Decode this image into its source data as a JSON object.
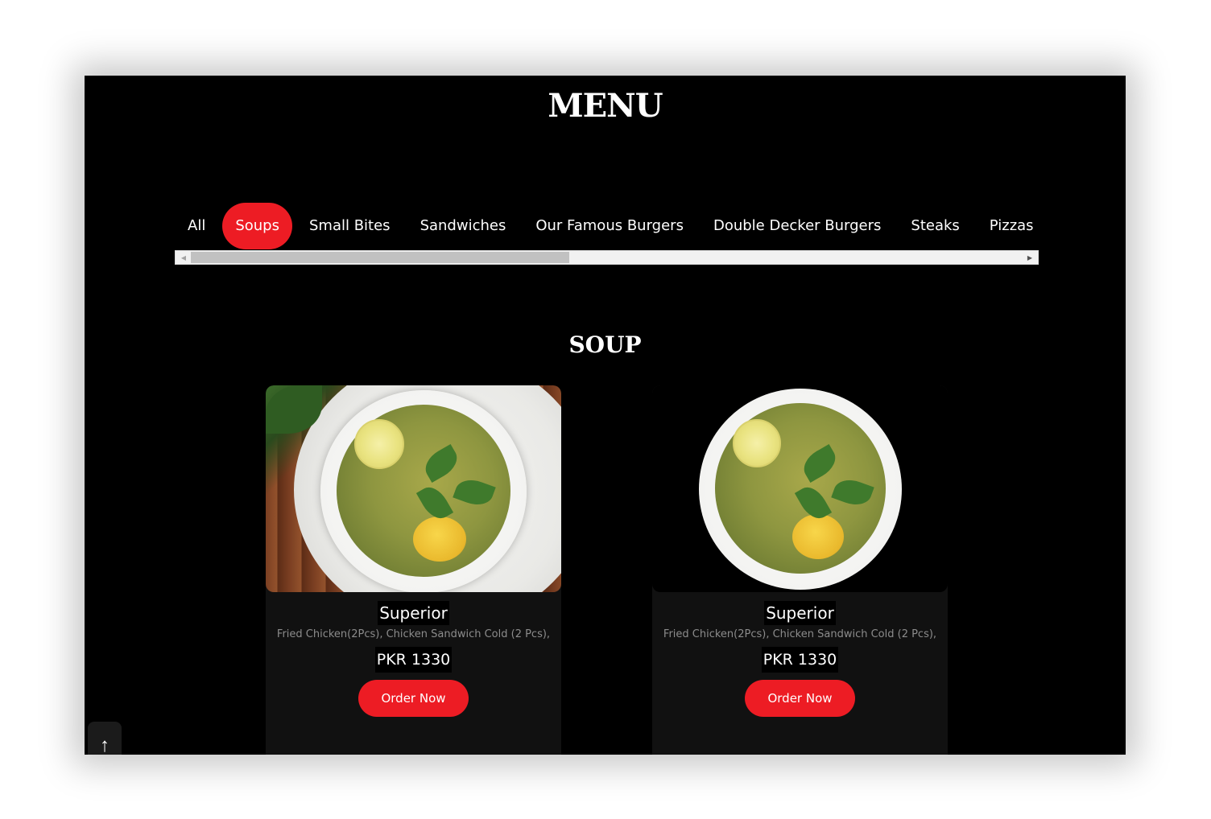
{
  "menu": {
    "title": "MENU"
  },
  "tabs": [
    {
      "label": "All",
      "active": false
    },
    {
      "label": "Soups",
      "active": true
    },
    {
      "label": "Small Bites",
      "active": false
    },
    {
      "label": "Sandwiches",
      "active": false
    },
    {
      "label": "Our Famous Burgers",
      "active": false
    },
    {
      "label": "Double Decker Burgers",
      "active": false
    },
    {
      "label": "Steaks",
      "active": false
    },
    {
      "label": "Pizzas",
      "active": false
    }
  ],
  "scrollbar": {
    "left_arrow": "◀",
    "right_arrow": "▶"
  },
  "section": {
    "title": "SOUP"
  },
  "cards": [
    {
      "name": "Superior",
      "description": "Fried Chicken(2Pcs), Chicken Sandwich Cold (2 Pcs),",
      "price": "PKR 1330",
      "order_label": "Order Now"
    },
    {
      "name": "Superior",
      "description": "Fried Chicken(2Pcs), Chicken Sandwich Cold (2 Pcs),",
      "price": "PKR 1330",
      "order_label": "Order Now"
    }
  ],
  "back_to_top": {
    "icon": "arrow-up-icon",
    "glyph": "↑"
  },
  "colors": {
    "accent": "#ed1c24",
    "background": "#000000",
    "card": "#111111"
  }
}
